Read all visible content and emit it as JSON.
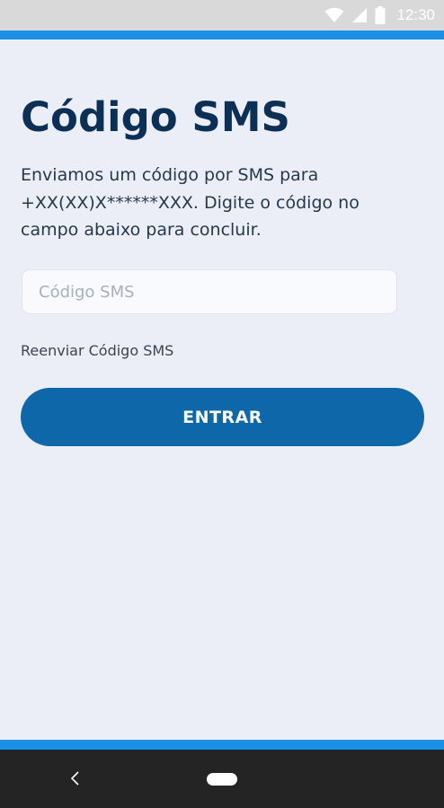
{
  "status_bar": {
    "time": "12:30",
    "icons": [
      "wifi-icon",
      "signal-icon",
      "battery-icon"
    ]
  },
  "page": {
    "title": "Código SMS",
    "description": "Enviamos um código por SMS para +XX(XX)X******XXX. Digite o código no campo abaixo para concluir.",
    "sms_input": {
      "placeholder": "Código SMS",
      "value": ""
    },
    "resend_label": "Reenviar Código SMS",
    "enter_button_label": "ENTRAR"
  },
  "nav_bar": {
    "icons": [
      "back-icon",
      "home-pill-icon"
    ]
  },
  "colors": {
    "background": "#ebeef7",
    "accent_bar": "#1a8fe3",
    "title": "#0c2f55",
    "primary_button": "#0d67a8",
    "nav_bar": "#242424"
  }
}
